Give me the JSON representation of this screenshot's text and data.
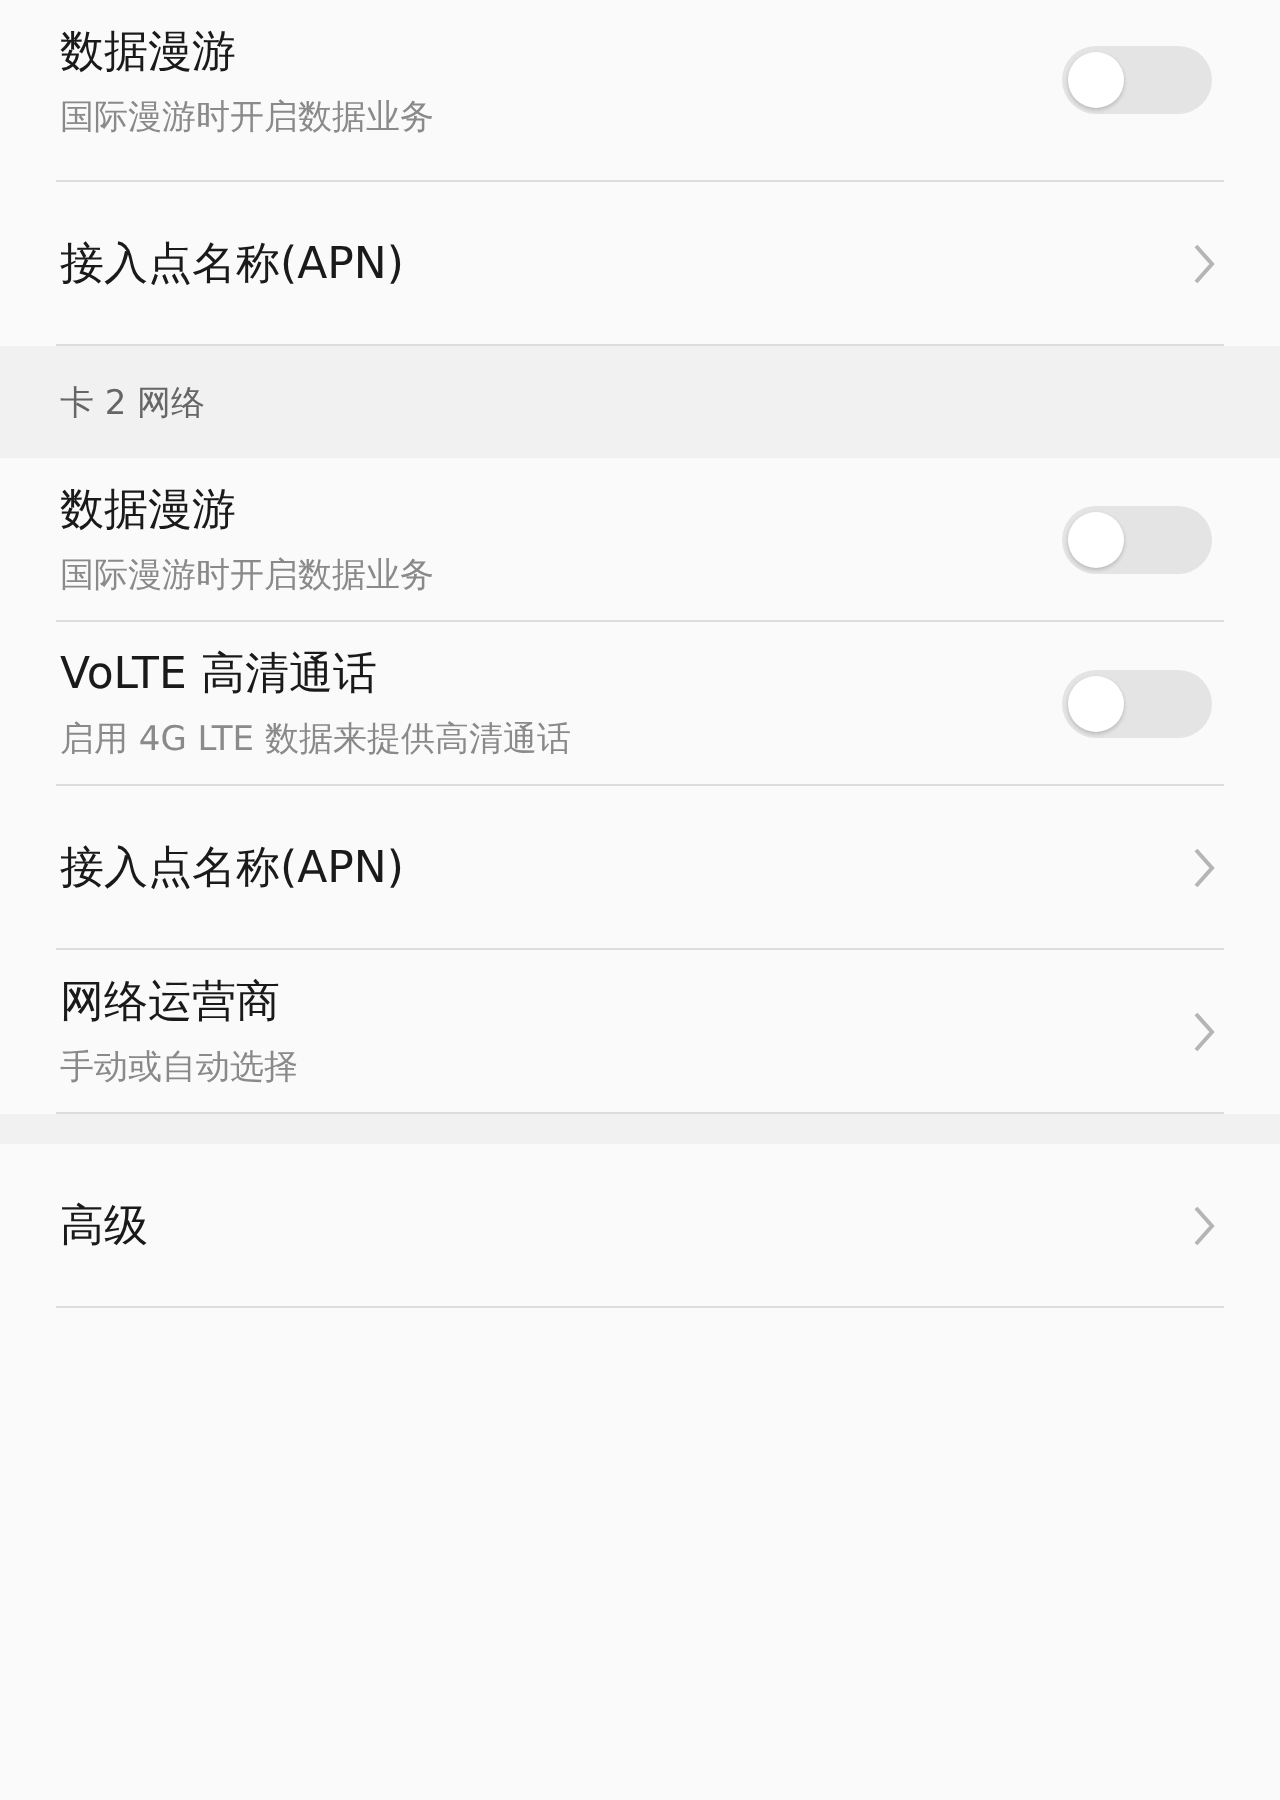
{
  "sections": [
    {
      "items": [
        {
          "kind": "toggle",
          "title": "数据漫游",
          "subtitle": "国际漫游时开启数据业务",
          "on": false
        },
        {
          "kind": "link",
          "title": "接入点名称(APN)"
        }
      ]
    },
    {
      "header": "卡 2 网络",
      "items": [
        {
          "kind": "toggle",
          "title": "数据漫游",
          "subtitle": "国际漫游时开启数据业务",
          "on": false
        },
        {
          "kind": "toggle",
          "title": "VoLTE 高清通话",
          "subtitle": "启用 4G LTE 数据来提供高清通话",
          "on": false
        },
        {
          "kind": "link",
          "title": "接入点名称(APN)"
        },
        {
          "kind": "link",
          "title": "网络运营商",
          "subtitle": "手动或自动选择"
        }
      ]
    },
    {
      "items": [
        {
          "kind": "link",
          "title": "高级"
        }
      ]
    }
  ]
}
